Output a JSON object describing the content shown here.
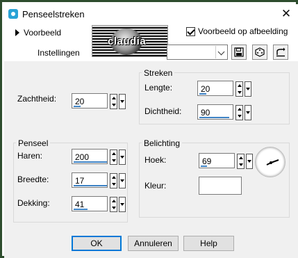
{
  "window": {
    "title": "Penseelstreken",
    "close_glyph": "✕"
  },
  "top": {
    "voorbeeld_label": "Voorbeeld",
    "preview_watermark": "claudia",
    "preview_on_image_label": "Voorbeeld op afbeelding",
    "preview_on_image_checked": true,
    "instellingen_label": "Instellingen",
    "preset_value": ""
  },
  "zachtheid": {
    "label": "Zachtheid:",
    "value": "20",
    "fill_percent": 20
  },
  "streken": {
    "title": "Streken",
    "lengte": {
      "label": "Lengte:",
      "value": "20",
      "fill_percent": 20
    },
    "dichtheid": {
      "label": "Dichtheid:",
      "value": "90",
      "fill_percent": 90
    }
  },
  "penseel": {
    "title": "Penseel",
    "haren": {
      "label": "Haren:",
      "value": "200",
      "fill_percent": 100
    },
    "breedte": {
      "label": "Breedte:",
      "value": "17",
      "fill_percent": 100
    },
    "dekking": {
      "label": "Dekking:",
      "value": "41",
      "fill_percent": 41
    }
  },
  "belichting": {
    "title": "Belichting",
    "hoek": {
      "label": "Hoek:",
      "value": "69",
      "fill_percent": 19
    },
    "kleur": {
      "label": "Kleur:",
      "color": "#ffffff"
    }
  },
  "footer": {
    "ok": "OK",
    "annuleren": "Annuleren",
    "help": "Help"
  },
  "colors": {
    "accent": "#3d82c4",
    "dialog_bg": "#f0f0f0",
    "frame": "#2e4d2e"
  }
}
